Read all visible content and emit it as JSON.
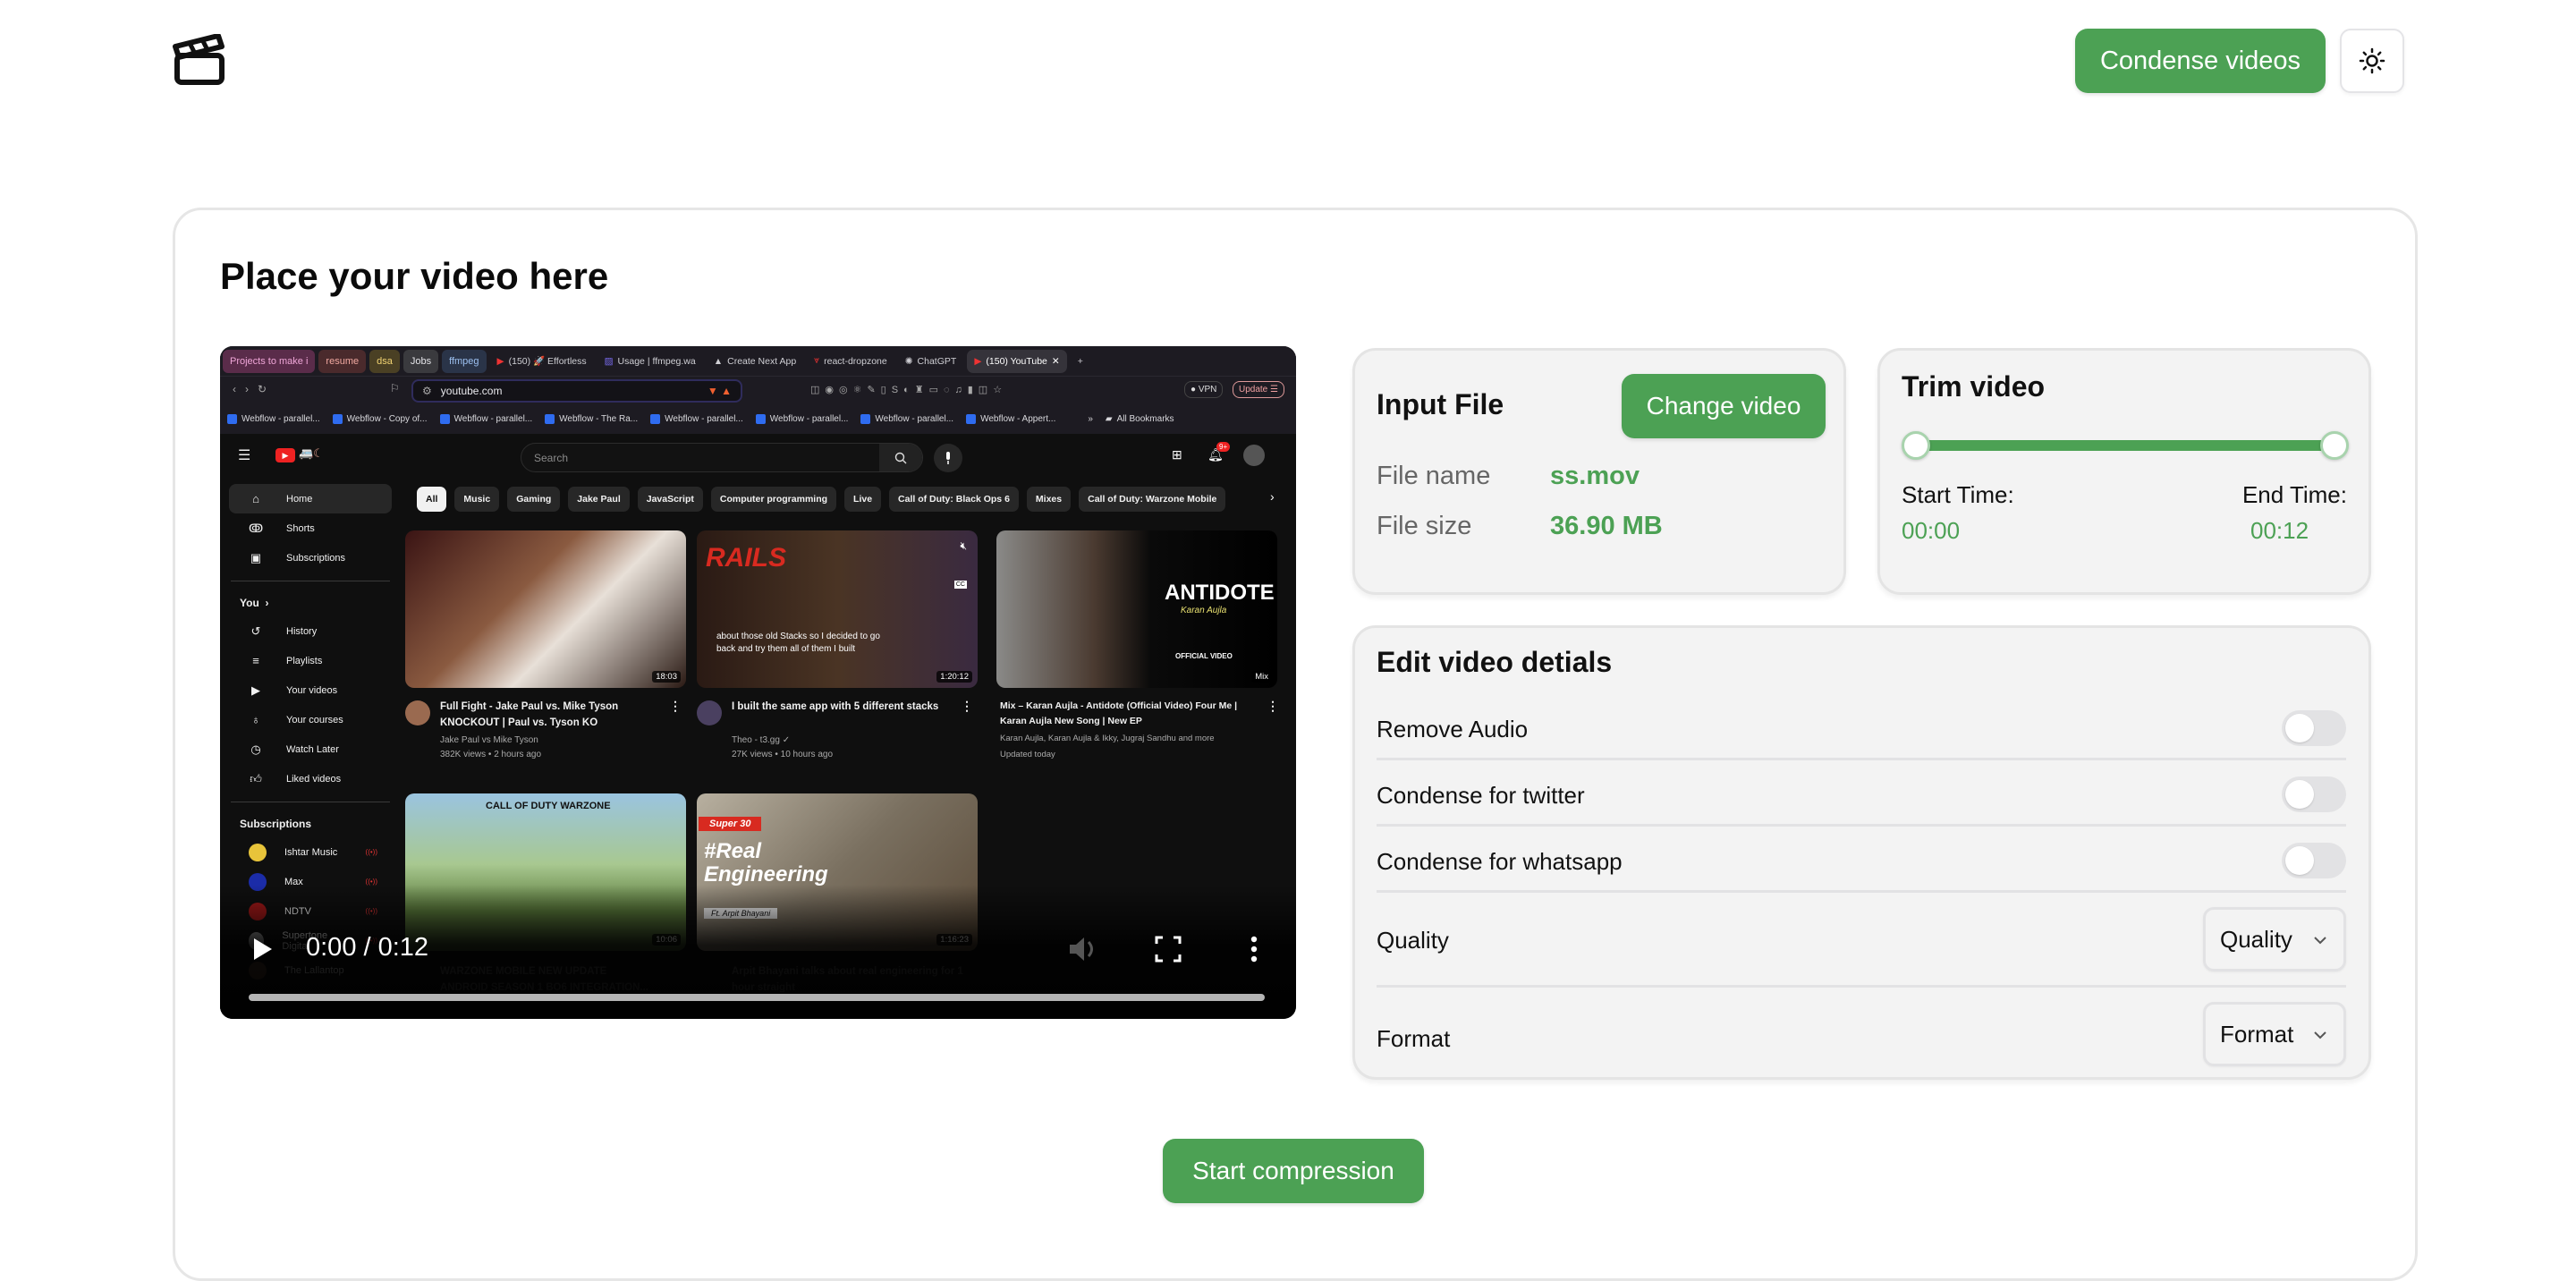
{
  "header": {
    "logo_icon": "clapperboard-icon",
    "condense_button": "Condense videos",
    "theme_icon": "sun-icon"
  },
  "main": {
    "title": "Place your video here"
  },
  "video_player": {
    "time_display": "0:00 / 0:12",
    "current_time": "0:00",
    "duration": "0:12",
    "progress_fraction": 0.0,
    "screenshot": {
      "browser": {
        "tab_groups": [
          {
            "label": "Projects to make i",
            "bg": "#5a2c4a",
            "fg": "#f0a6d8"
          },
          {
            "label": "resume",
            "bg": "#4a2a2c",
            "fg": "#f0a8a0"
          },
          {
            "label": "dsa",
            "bg": "#4a4024",
            "fg": "#f2d472"
          },
          {
            "label": "Jobs",
            "bg": "#3a3a3e",
            "fg": "#e4e4e8"
          },
          {
            "label": "ffmpeg",
            "bg": "#2a3448",
            "fg": "#9cc0f0"
          }
        ],
        "tabs": [
          {
            "label": "(150) 🚀 Effortless",
            "icon": "youtube-icon"
          },
          {
            "label": "Usage | ffmpeg.wa",
            "icon": "ffmpeg-icon"
          },
          {
            "label": "Create Next App",
            "icon": "nextjs-icon"
          },
          {
            "label": "react-dropzone",
            "icon": "dropzone-icon"
          },
          {
            "label": "ChatGPT",
            "icon": "chatgpt-icon"
          },
          {
            "label": "(150) YouTube",
            "icon": "youtube-icon",
            "active": true
          }
        ],
        "url": "youtube.com",
        "vpn_label": "VPN",
        "update_label": "Update",
        "bookmarks": [
          "Webflow - parallel...",
          "Webflow - Copy of...",
          "Webflow - parallel...",
          "Webflow - The Ra...",
          "Webflow - parallel...",
          "Webflow - parallel...",
          "Webflow - parallel...",
          "Webflow - Appert..."
        ],
        "all_bookmarks": "All Bookmarks"
      },
      "youtube": {
        "search_placeholder": "Search",
        "notification_badge": "9+",
        "sidebar_main": [
          {
            "label": "Home",
            "icon": "home-icon",
            "active": true
          },
          {
            "label": "Shorts",
            "icon": "shorts-icon"
          },
          {
            "label": "Subscriptions",
            "icon": "subscriptions-icon"
          }
        ],
        "you_heading": "You",
        "sidebar_you": [
          {
            "label": "History",
            "icon": "history-icon"
          },
          {
            "label": "Playlists",
            "icon": "playlists-icon"
          },
          {
            "label": "Your videos",
            "icon": "your-videos-icon"
          },
          {
            "label": "Your courses",
            "icon": "bulb-icon"
          },
          {
            "label": "Watch Later",
            "icon": "clock-icon"
          },
          {
            "label": "Liked videos",
            "icon": "thumbs-up-icon"
          }
        ],
        "subscriptions_heading": "Subscriptions",
        "subscriptions": [
          {
            "label": "Ishtar Music",
            "color": "#e8c43a"
          },
          {
            "label": "Max",
            "color": "#1b2ca8"
          },
          {
            "label": "NDTV",
            "color": "#a01818"
          },
          {
            "label": "Supertone Digital",
            "color": "#9a9a9a"
          },
          {
            "label": "The Lallantop",
            "color": "#5a4030"
          }
        ],
        "chips": [
          "All",
          "Music",
          "Gaming",
          "Jake Paul",
          "JavaScript",
          "Computer programming",
          "Live",
          "Call of Duty: Black Ops 6",
          "Mixes",
          "Call of Duty: Warzone Mobile"
        ],
        "videos": [
          {
            "title": "Full Fight - Jake Paul vs. Mike Tyson KNOCKOUT | Paul vs. Tyson KO",
            "channel": "Jake Paul vs Mike Tyson",
            "meta": "382K views • 2 hours ago",
            "duration": "18:03"
          },
          {
            "title": "I built the same app with 5 different stacks",
            "channel": "Theo - t3.gg ✓",
            "meta": "27K views • 10 hours ago",
            "duration": "1:20:12",
            "caption": "about those old Stacks so I decided to go back and try them all of them I built"
          },
          {
            "title": "Mix – Karan Aujla - Antidote (Official Video) Four Me | Karan Aujla New Song | New EP",
            "channel": "Karan Aujla, Karan Aujla & Ikky, Jugraj Sandhu and more",
            "meta": "Updated today",
            "duration": "Mix",
            "thumb_text": "ANTIDOTE",
            "thumb_sub": "Karan Aujla",
            "thumb_tag": "OFFICIAL VIDEO"
          },
          {
            "title": "WARZONE MOBILE NEW UPDATE ANDROID SEASON 1 BO6 INTEGRATION...",
            "channel": "",
            "meta": "",
            "duration": "10:06",
            "thumb_text": "CALL OF DUTY  WARZONE"
          },
          {
            "title": "Arpit Bhayani talks about real engineering for 1 hour straight",
            "channel": "",
            "meta": "",
            "duration": "1:16:23",
            "thumb_tag": "Super 30",
            "thumb_text": "#Real Engineering",
            "thumb_sub": "Ft. Arpit Bhayani"
          }
        ]
      }
    }
  },
  "input_file": {
    "title": "Input File",
    "change_button": "Change video",
    "rows": [
      {
        "label": "File name",
        "value": "ss.mov"
      },
      {
        "label": "File size",
        "value": "36.90 MB"
      }
    ]
  },
  "trim": {
    "title": "Trim video",
    "start_fraction": 0.0,
    "end_fraction": 1.0,
    "start_label": "Start Time:",
    "start_value": "00:00",
    "end_label": "End Time:",
    "end_value": "00:12"
  },
  "edit": {
    "title": "Edit video detials",
    "toggles": [
      {
        "label": "Remove Audio",
        "checked": false
      },
      {
        "label": "Condense for twitter",
        "checked": false
      },
      {
        "label": "Condense for whatsapp",
        "checked": false
      }
    ],
    "selects": [
      {
        "label": "Quality",
        "value": "Quality"
      },
      {
        "label": "Format",
        "value": "Format"
      }
    ]
  },
  "start_button": "Start compression",
  "colors": {
    "accent_green": "#4ca154",
    "panel_bg": "#f3f3f3",
    "border": "#e4e4e4"
  }
}
